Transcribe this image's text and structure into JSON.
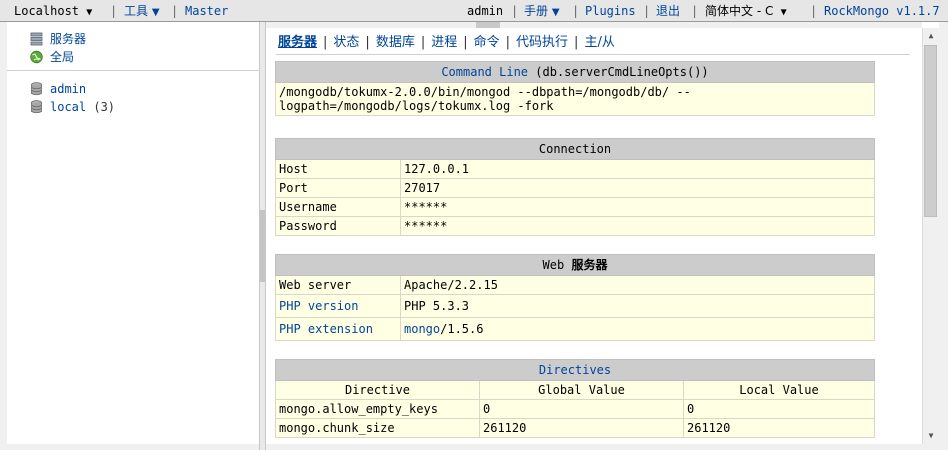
{
  "topbar": {
    "host": "Localhost",
    "tools": "工具",
    "master": "Master",
    "user": "admin",
    "manual": "手册",
    "plugins": "Plugins",
    "logout": "退出",
    "language": "简体中文 - C",
    "version": "RockMongo v1.1.7",
    "sep": "|",
    "arrow": "▼"
  },
  "sidebar": {
    "server": "服务器",
    "overview": "全局",
    "databases": [
      {
        "name": "admin",
        "count": ""
      },
      {
        "name": "local",
        "count": "(3)"
      }
    ]
  },
  "tabs": [
    "服务器",
    "状态",
    "数据库",
    "进程",
    "命令",
    "代码执行",
    "主/从"
  ],
  "command_line": {
    "title_link": "Command Line",
    "title_suffix": "(db.serverCmdLineOpts())",
    "value": "/mongodb/tokumx-2.0.0/bin/mongod --dbpath=/mongodb/db/ --logpath=/mongodb/logs/tokumx.log -fork"
  },
  "connection": {
    "title": "Connection",
    "rows": [
      {
        "label": "Host",
        "value": "127.0.0.1"
      },
      {
        "label": "Port",
        "value": "27017"
      },
      {
        "label": "Username",
        "value": "******"
      },
      {
        "label": "Password",
        "value": "******"
      }
    ]
  },
  "web_server": {
    "title_prefix": "Web",
    "title_suffix": "服务器",
    "rows": [
      {
        "label": "Web server",
        "value": "Apache/2.2.15"
      },
      {
        "label": "PHP version",
        "value": "PHP 5.3.3"
      },
      {
        "label": "PHP extension",
        "value_link": "mongo",
        "value_rest": "/1.5.6"
      }
    ]
  },
  "directives": {
    "title": "Directives",
    "headers": [
      "Directive",
      "Global Value",
      "Local Value"
    ],
    "rows": [
      [
        "mongo.allow_empty_keys",
        "0",
        "0"
      ],
      [
        "mongo.chunk_size",
        "261120",
        "261120"
      ]
    ]
  },
  "colors": {
    "link": "#004499",
    "header_bg": "#cccccc",
    "cell_bg": "#ffffe4",
    "topbar_bg": "#e6e6e6"
  },
  "icons": {
    "server": "server-stack-icon",
    "overview": "globe-icon",
    "database": "database-icon"
  }
}
